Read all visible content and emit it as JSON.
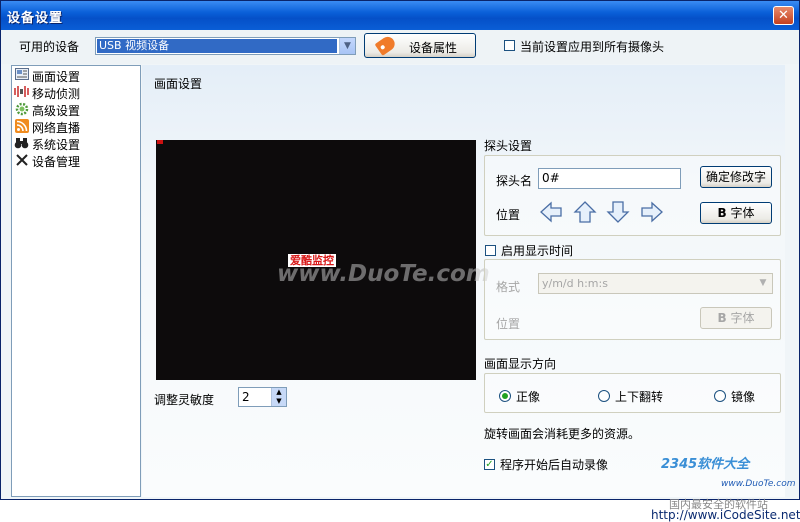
{
  "window": {
    "title": "设备设置",
    "close_symbol": "✕"
  },
  "top": {
    "device_label": "可用的设备",
    "device_value": "USB 视频设备",
    "properties_button": "设备属性",
    "apply_all_label": "当前设置应用到所有摄像头",
    "apply_all_checked": false
  },
  "sidebar": {
    "items": [
      {
        "label": "画面设置",
        "icon": "screen-icon"
      },
      {
        "label": "移动侦测",
        "icon": "motion-icon"
      },
      {
        "label": "高级设置",
        "icon": "gear-icon"
      },
      {
        "label": "网络直播",
        "icon": "rss-icon"
      },
      {
        "label": "系统设置",
        "icon": "binoculars-icon"
      },
      {
        "label": "设备管理",
        "icon": "tools-icon"
      }
    ]
  },
  "panel": {
    "title": "画面设置",
    "preview_overlay": "爱酷监控",
    "watermark": "www.DuoTe.com",
    "sensitivity_label": "调整灵敏度",
    "sensitivity_value": "2"
  },
  "probe": {
    "group_title": "探头设置",
    "name_label": "探头名",
    "name_value": "0#",
    "confirm_button": "确定修改字",
    "position_label": "位置",
    "font_button": "字体",
    "font_button_b": "B"
  },
  "time": {
    "enable_label": "启用显示时间",
    "enabled": false,
    "format_label": "格式",
    "format_value": "y/m/d h:m:s",
    "position_label": "位置",
    "font_button": "字体",
    "font_button_b": "B"
  },
  "orientation": {
    "group_title": "画面显示方向",
    "options": [
      "正像",
      "上下翻转",
      "镜像"
    ],
    "selected": "正像"
  },
  "notes": {
    "rotate_note": "旋转画面会消耗更多的资源。",
    "auto_record_label": "程序开始后自动录像",
    "auto_record_checked": true
  },
  "branding": {
    "logo": "2345软件大全",
    "logo_url": "www.DuoTe.com",
    "caption": "国内最安全的软件站",
    "site_url": "http://www.iCodeSite.net"
  },
  "colors": {
    "titlebar": "#0a5fd8",
    "selection": "#316ac5",
    "overlay_red": "#d81818",
    "check_green": "#21a121"
  }
}
